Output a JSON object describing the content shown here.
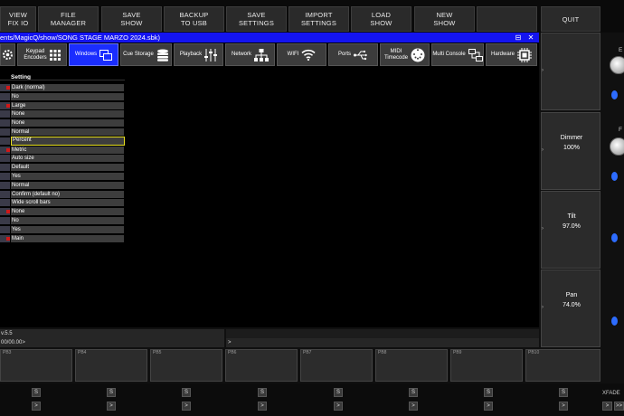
{
  "top_menu": {
    "buttons": [
      "VIEW\nFIX IO",
      "FILE\nMANAGER",
      "SAVE\nSHOW",
      "BACKUP\nTO USB",
      "SAVE\nSETTINGS",
      "IMPORT\nSETTINGS",
      "LOAD\nSHOW",
      "NEW\nSHOW",
      "",
      "QUIT"
    ]
  },
  "window": {
    "title": "ents/MagicQ/show/SONG STAGE MARZO 2024.sbk)",
    "maximize_glyph": "⊟",
    "close_glyph": "✕"
  },
  "toolbar": {
    "tabs": [
      {
        "label": "",
        "icon": "settings-icon"
      },
      {
        "label": "Keypad\nEncoders",
        "icon": "keypad-grid-icon"
      },
      {
        "label": "Windows",
        "icon": "windows-icon",
        "active": true
      },
      {
        "label": "Cue Storage",
        "icon": "database-icon"
      },
      {
        "label": "Playback",
        "icon": "sliders-icon"
      },
      {
        "label": "Network",
        "icon": "network-tree-icon"
      },
      {
        "label": "WIFI",
        "icon": "wifi-icon"
      },
      {
        "label": "Ports",
        "icon": "usb-icon"
      },
      {
        "label": "MIDI\nTimecode",
        "icon": "midi-icon"
      },
      {
        "label": "Multi Console",
        "icon": "multi-console-icon"
      },
      {
        "label": "Hardware",
        "icon": "chip-icon"
      }
    ]
  },
  "settings": {
    "header": "Setting",
    "rows": [
      {
        "value": "Dark (normal)",
        "flag": true
      },
      {
        "value": "No",
        "flag": false
      },
      {
        "value": "Large",
        "flag": true
      },
      {
        "value": "None",
        "flag": false
      },
      {
        "value": "None",
        "flag": false
      },
      {
        "value": "Normal",
        "flag": false
      },
      {
        "value": "Percent",
        "flag": false,
        "selected": true
      },
      {
        "value": "Metric",
        "flag": true
      },
      {
        "value": "Auto size",
        "flag": false
      },
      {
        "value": "Default",
        "flag": false
      },
      {
        "value": "Yes",
        "flag": false
      },
      {
        "value": "Normal",
        "flag": false
      },
      {
        "value": "Confirm (default no)",
        "flag": false
      },
      {
        "value": "Wide scroll bars",
        "flag": false
      },
      {
        "value": "None",
        "flag": true
      },
      {
        "value": "No",
        "flag": false
      },
      {
        "value": "Yes",
        "flag": false
      },
      {
        "value": "Main",
        "flag": true
      }
    ]
  },
  "command": {
    "line1": "v.5.5",
    "line2": "00/00.00>",
    "prompt": ">"
  },
  "playbacks": [
    "PB3",
    "PB4",
    "PB5",
    "PB6",
    "PB7",
    "PB8",
    "PB9",
    "PB10"
  ],
  "encoders": [
    {
      "label": "",
      "value": ""
    },
    {
      "label": "Dimmer",
      "value": "100%"
    },
    {
      "label": "Tilt",
      "value": "97.0%"
    },
    {
      "label": "Pan",
      "value": "74.0%"
    }
  ],
  "right_knob_labels": [
    "E",
    "F"
  ],
  "strip": {
    "s_label": "S",
    "arrow_label": ">",
    "xfade_label": "XFADE",
    "xfade_buttons": [
      ">",
      ">>"
    ]
  },
  "colors": {
    "title_bar": "#1414f0",
    "active_tab": "#1a2dff",
    "flag_red": "#d01818",
    "selected_outline": "#e8e020",
    "knob_dot": "#2d6cff"
  }
}
